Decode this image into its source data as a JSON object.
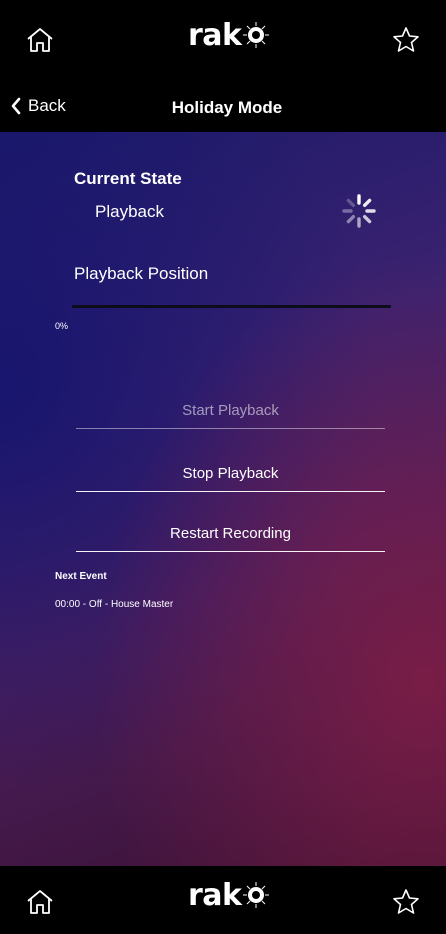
{
  "header": {
    "home_icon": "home-icon",
    "logo_text": "rako",
    "favourite_icon": "star-icon"
  },
  "nav": {
    "back_label": "Back",
    "title": "Holiday Mode"
  },
  "state": {
    "label": "Current State",
    "value": "Playback",
    "busy_icon": "activity-spinner-icon"
  },
  "playback_position": {
    "label": "Playback Position",
    "percent_text": "0%",
    "progress": 0
  },
  "actions": {
    "start_label": "Start Playback",
    "stop_label": "Stop Playback",
    "restart_label": "Restart Recording"
  },
  "next_event": {
    "label": "Next Event",
    "value": "00:00 - Off - House Master"
  },
  "footer": {
    "home_icon": "home-icon",
    "logo_text": "rako",
    "favourite_icon": "star-icon"
  },
  "colors": {
    "bar_background": "#000000",
    "gradient_blue": "#1c1a6a",
    "gradient_purple": "#4a1f5e",
    "gradient_magenta": "#821e46"
  }
}
